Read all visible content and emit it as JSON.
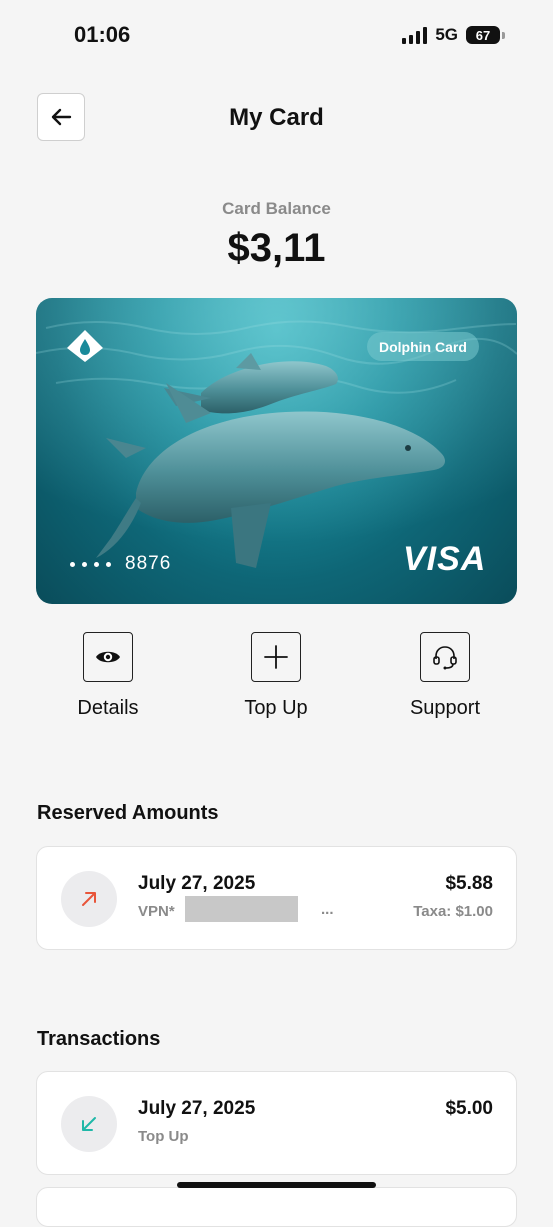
{
  "status_bar": {
    "time": "01:06",
    "network": "5G",
    "battery": "67"
  },
  "header": {
    "title": "My Card",
    "back_icon": "arrow-left-icon"
  },
  "balance": {
    "label": "Card Balance",
    "value": "$3,11"
  },
  "card": {
    "name": "Dolphin Card",
    "last4": "8876",
    "network": "VISA",
    "logo_icon": "droplet-logo-icon",
    "colors": {
      "water_light": "#3fb4c0",
      "water_dark": "#0a4c5a"
    }
  },
  "actions": [
    {
      "label": "Details",
      "icon": "eye-icon"
    },
    {
      "label": "Top Up",
      "icon": "plus-icon"
    },
    {
      "label": "Support",
      "icon": "headset-icon"
    }
  ],
  "reserved": {
    "title": "Reserved Amounts",
    "items": [
      {
        "date": "July 27, 2025",
        "merchant": "VPN*",
        "ellipsis": "...",
        "amount": "$5.88",
        "fee": "Taxa: $1.00",
        "icon": "arrow-up-right-icon",
        "icon_color": "#e8553a"
      }
    ]
  },
  "transactions": {
    "title": "Transactions",
    "items": [
      {
        "date": "July 27, 2025",
        "type": "Top Up",
        "amount": "$5.00",
        "icon": "arrow-down-left-icon",
        "icon_color": "#1fb8a8"
      }
    ]
  }
}
